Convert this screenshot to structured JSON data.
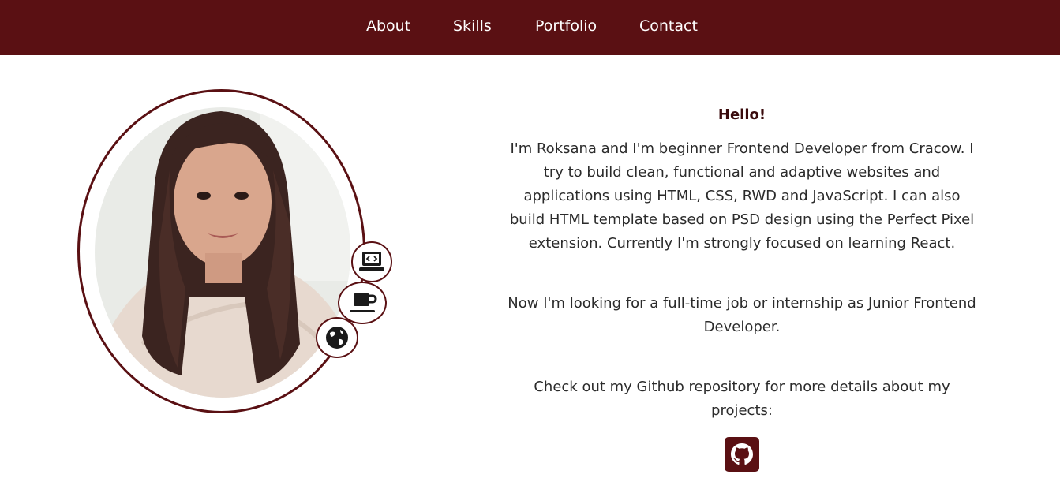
{
  "nav": {
    "items": [
      {
        "label": "About"
      },
      {
        "label": "Skills"
      },
      {
        "label": "Portfolio"
      },
      {
        "label": "Contact"
      }
    ]
  },
  "profile": {
    "badges": [
      "laptop-code-icon",
      "coffee-icon",
      "globe-icon"
    ]
  },
  "about": {
    "heading": "Hello!",
    "paragraph_1": "I'm Roksana and I'm beginner Frontend Developer from Cracow. I try to build clean, functional and adaptive websites and applications using HTML, CSS, RWD and JavaScript. I can also build HTML template based on PSD design using the Perfect Pixel extension. Currently I'm strongly focused on learning React.",
    "paragraph_2": "Now I'm looking for a full-time job or internship as Junior Frontend Developer.",
    "paragraph_3": "Check out my Github repository for more details about my projects:",
    "github_icon": "github-icon"
  },
  "colors": {
    "accent": "#5a1013",
    "nav_text": "#ffffff",
    "body_text": "#2b2b2b"
  }
}
